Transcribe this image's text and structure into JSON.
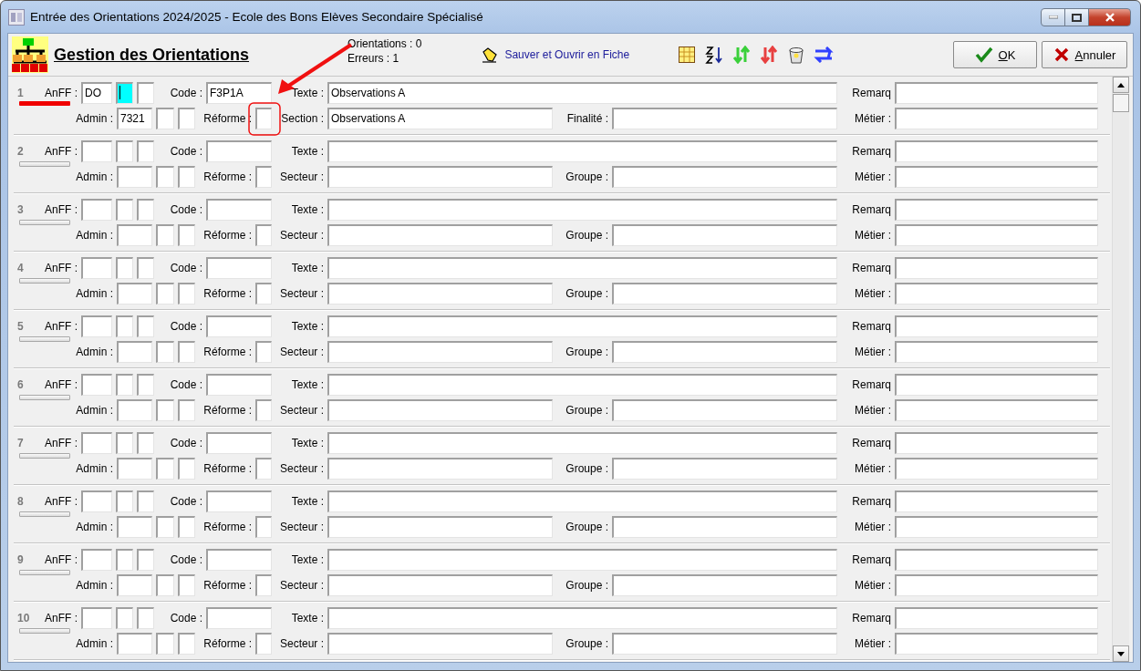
{
  "window": {
    "title": "Entrée des Orientations 2024/2025  -  Ecole des Bons Elèves Secondaire Spécialisé"
  },
  "header": {
    "title": "Gestion des Orientations",
    "stats": [
      "Orientations : 0",
      "Erreurs : 1"
    ],
    "save_link": "Sauver et Ouvrir en Fiche"
  },
  "buttons": [
    {
      "label": "OK",
      "kind": "ok"
    },
    {
      "label": "Annuler",
      "kind": "cancel"
    }
  ],
  "rows": [
    {
      "number": "1",
      "marked": true,
      "line1": [
        {
          "label": "AnFF :",
          "inputs": [
            {
              "value": "DO",
              "focused": false
            },
            {
              "focused": true
            },
            {
              "focused": false
            }
          ]
        },
        {
          "label": "Code :",
          "inputs": [
            {
              "value": "F3P1A",
              "focused": false
            }
          ]
        },
        {
          "label": "Texte :",
          "inputs": [
            {
              "value": "Observations A",
              "focused": false
            }
          ]
        },
        {
          "label": "Remarq",
          "inputs": [
            {
              "focused": false
            }
          ]
        }
      ],
      "line2": [
        {
          "label": "Admin :",
          "inputs": [
            {
              "value": "7321",
              "focused": false
            },
            {
              "focused": false
            },
            {
              "focused": false
            }
          ]
        },
        {
          "label": "Réforme :",
          "inputs": [
            {
              "focused": false
            }
          ]
        },
        {
          "label": "Section :",
          "inputs": [
            {
              "value": "Observations A",
              "focused": false
            }
          ]
        },
        {
          "label": "Finalité :",
          "inputs": [
            {
              "focused": false
            }
          ]
        },
        {
          "label": "Métier :",
          "inputs": [
            {
              "focused": false
            }
          ]
        }
      ]
    },
    {
      "number": "2",
      "marked": false,
      "line1": [
        {
          "label": "AnFF :",
          "inputs": [
            {
              "focused": false
            },
            {
              "focused": false
            },
            {
              "focused": false
            }
          ]
        },
        {
          "label": "Code :",
          "inputs": [
            {
              "focused": false
            }
          ]
        },
        {
          "label": "Texte :",
          "inputs": [
            {
              "focused": false
            }
          ]
        },
        {
          "label": "Remarq",
          "inputs": [
            {
              "focused": false
            }
          ]
        }
      ],
      "line2": [
        {
          "label": "Admin :",
          "inputs": [
            {
              "focused": false
            },
            {
              "focused": false
            },
            {
              "focused": false
            }
          ]
        },
        {
          "label": "Réforme :",
          "inputs": [
            {
              "focused": false
            }
          ]
        },
        {
          "label": "Secteur :",
          "inputs": [
            {
              "focused": false
            }
          ]
        },
        {
          "label": "Groupe :",
          "inputs": [
            {
              "focused": false
            }
          ]
        },
        {
          "label": "Métier :",
          "inputs": [
            {
              "focused": false
            }
          ]
        }
      ]
    },
    {
      "number": "3",
      "marked": false,
      "line1": [
        {
          "label": "AnFF :",
          "inputs": [
            {
              "focused": false
            },
            {
              "focused": false
            },
            {
              "focused": false
            }
          ]
        },
        {
          "label": "Code :",
          "inputs": [
            {
              "focused": false
            }
          ]
        },
        {
          "label": "Texte :",
          "inputs": [
            {
              "focused": false
            }
          ]
        },
        {
          "label": "Remarq",
          "inputs": [
            {
              "focused": false
            }
          ]
        }
      ],
      "line2": [
        {
          "label": "Admin :",
          "inputs": [
            {
              "focused": false
            },
            {
              "focused": false
            },
            {
              "focused": false
            }
          ]
        },
        {
          "label": "Réforme :",
          "inputs": [
            {
              "focused": false
            }
          ]
        },
        {
          "label": "Secteur :",
          "inputs": [
            {
              "focused": false
            }
          ]
        },
        {
          "label": "Groupe :",
          "inputs": [
            {
              "focused": false
            }
          ]
        },
        {
          "label": "Métier :",
          "inputs": [
            {
              "focused": false
            }
          ]
        }
      ]
    },
    {
      "number": "4",
      "marked": false,
      "line1": [
        {
          "label": "AnFF :",
          "inputs": [
            {
              "focused": false
            },
            {
              "focused": false
            },
            {
              "focused": false
            }
          ]
        },
        {
          "label": "Code :",
          "inputs": [
            {
              "focused": false
            }
          ]
        },
        {
          "label": "Texte :",
          "inputs": [
            {
              "focused": false
            }
          ]
        },
        {
          "label": "Remarq",
          "inputs": [
            {
              "focused": false
            }
          ]
        }
      ],
      "line2": [
        {
          "label": "Admin :",
          "inputs": [
            {
              "focused": false
            },
            {
              "focused": false
            },
            {
              "focused": false
            }
          ]
        },
        {
          "label": "Réforme :",
          "inputs": [
            {
              "focused": false
            }
          ]
        },
        {
          "label": "Secteur :",
          "inputs": [
            {
              "focused": false
            }
          ]
        },
        {
          "label": "Groupe :",
          "inputs": [
            {
              "focused": false
            }
          ]
        },
        {
          "label": "Métier :",
          "inputs": [
            {
              "focused": false
            }
          ]
        }
      ]
    },
    {
      "number": "5",
      "marked": false,
      "line1": [
        {
          "label": "AnFF :",
          "inputs": [
            {
              "focused": false
            },
            {
              "focused": false
            },
            {
              "focused": false
            }
          ]
        },
        {
          "label": "Code :",
          "inputs": [
            {
              "focused": false
            }
          ]
        },
        {
          "label": "Texte :",
          "inputs": [
            {
              "focused": false
            }
          ]
        },
        {
          "label": "Remarq",
          "inputs": [
            {
              "focused": false
            }
          ]
        }
      ],
      "line2": [
        {
          "label": "Admin :",
          "inputs": [
            {
              "focused": false
            },
            {
              "focused": false
            },
            {
              "focused": false
            }
          ]
        },
        {
          "label": "Réforme :",
          "inputs": [
            {
              "focused": false
            }
          ]
        },
        {
          "label": "Secteur :",
          "inputs": [
            {
              "focused": false
            }
          ]
        },
        {
          "label": "Groupe :",
          "inputs": [
            {
              "focused": false
            }
          ]
        },
        {
          "label": "Métier :",
          "inputs": [
            {
              "focused": false
            }
          ]
        }
      ]
    },
    {
      "number": "6",
      "marked": false,
      "line1": [
        {
          "label": "AnFF :",
          "inputs": [
            {
              "focused": false
            },
            {
              "focused": false
            },
            {
              "focused": false
            }
          ]
        },
        {
          "label": "Code :",
          "inputs": [
            {
              "focused": false
            }
          ]
        },
        {
          "label": "Texte :",
          "inputs": [
            {
              "focused": false
            }
          ]
        },
        {
          "label": "Remarq",
          "inputs": [
            {
              "focused": false
            }
          ]
        }
      ],
      "line2": [
        {
          "label": "Admin :",
          "inputs": [
            {
              "focused": false
            },
            {
              "focused": false
            },
            {
              "focused": false
            }
          ]
        },
        {
          "label": "Réforme :",
          "inputs": [
            {
              "focused": false
            }
          ]
        },
        {
          "label": "Secteur :",
          "inputs": [
            {
              "focused": false
            }
          ]
        },
        {
          "label": "Groupe :",
          "inputs": [
            {
              "focused": false
            }
          ]
        },
        {
          "label": "Métier :",
          "inputs": [
            {
              "focused": false
            }
          ]
        }
      ]
    },
    {
      "number": "7",
      "marked": false,
      "line1": [
        {
          "label": "AnFF :",
          "inputs": [
            {
              "focused": false
            },
            {
              "focused": false
            },
            {
              "focused": false
            }
          ]
        },
        {
          "label": "Code :",
          "inputs": [
            {
              "focused": false
            }
          ]
        },
        {
          "label": "Texte :",
          "inputs": [
            {
              "focused": false
            }
          ]
        },
        {
          "label": "Remarq",
          "inputs": [
            {
              "focused": false
            }
          ]
        }
      ],
      "line2": [
        {
          "label": "Admin :",
          "inputs": [
            {
              "focused": false
            },
            {
              "focused": false
            },
            {
              "focused": false
            }
          ]
        },
        {
          "label": "Réforme :",
          "inputs": [
            {
              "focused": false
            }
          ]
        },
        {
          "label": "Secteur :",
          "inputs": [
            {
              "focused": false
            }
          ]
        },
        {
          "label": "Groupe :",
          "inputs": [
            {
              "focused": false
            }
          ]
        },
        {
          "label": "Métier :",
          "inputs": [
            {
              "focused": false
            }
          ]
        }
      ]
    },
    {
      "number": "8",
      "marked": false,
      "line1": [
        {
          "label": "AnFF :",
          "inputs": [
            {
              "focused": false
            },
            {
              "focused": false
            },
            {
              "focused": false
            }
          ]
        },
        {
          "label": "Code :",
          "inputs": [
            {
              "focused": false
            }
          ]
        },
        {
          "label": "Texte :",
          "inputs": [
            {
              "focused": false
            }
          ]
        },
        {
          "label": "Remarq",
          "inputs": [
            {
              "focused": false
            }
          ]
        }
      ],
      "line2": [
        {
          "label": "Admin :",
          "inputs": [
            {
              "focused": false
            },
            {
              "focused": false
            },
            {
              "focused": false
            }
          ]
        },
        {
          "label": "Réforme :",
          "inputs": [
            {
              "focused": false
            }
          ]
        },
        {
          "label": "Secteur :",
          "inputs": [
            {
              "focused": false
            }
          ]
        },
        {
          "label": "Groupe :",
          "inputs": [
            {
              "focused": false
            }
          ]
        },
        {
          "label": "Métier :",
          "inputs": [
            {
              "focused": false
            }
          ]
        }
      ]
    },
    {
      "number": "9",
      "marked": false,
      "line1": [
        {
          "label": "AnFF :",
          "inputs": [
            {
              "focused": false
            },
            {
              "focused": false
            },
            {
              "focused": false
            }
          ]
        },
        {
          "label": "Code :",
          "inputs": [
            {
              "focused": false
            }
          ]
        },
        {
          "label": "Texte :",
          "inputs": [
            {
              "focused": false
            }
          ]
        },
        {
          "label": "Remarq",
          "inputs": [
            {
              "focused": false
            }
          ]
        }
      ],
      "line2": [
        {
          "label": "Admin :",
          "inputs": [
            {
              "focused": false
            },
            {
              "focused": false
            },
            {
              "focused": false
            }
          ]
        },
        {
          "label": "Réforme :",
          "inputs": [
            {
              "focused": false
            }
          ]
        },
        {
          "label": "Secteur :",
          "inputs": [
            {
              "focused": false
            }
          ]
        },
        {
          "label": "Groupe :",
          "inputs": [
            {
              "focused": false
            }
          ]
        },
        {
          "label": "Métier :",
          "inputs": [
            {
              "focused": false
            }
          ]
        }
      ]
    },
    {
      "number": "10",
      "marked": false,
      "line1": [
        {
          "label": "AnFF :",
          "inputs": [
            {
              "focused": false
            },
            {
              "focused": false
            },
            {
              "focused": false
            }
          ]
        },
        {
          "label": "Code :",
          "inputs": [
            {
              "focused": false
            }
          ]
        },
        {
          "label": "Texte :",
          "inputs": [
            {
              "focused": false
            }
          ]
        },
        {
          "label": "Remarq",
          "inputs": [
            {
              "focused": false
            }
          ]
        }
      ],
      "line2": [
        {
          "label": "Admin :",
          "inputs": [
            {
              "focused": false
            },
            {
              "focused": false
            },
            {
              "focused": false
            }
          ]
        },
        {
          "label": "Réforme :",
          "inputs": [
            {
              "focused": false
            }
          ]
        },
        {
          "label": "Secteur :",
          "inputs": [
            {
              "focused": false
            }
          ]
        },
        {
          "label": "Groupe :",
          "inputs": [
            {
              "focused": false
            }
          ]
        },
        {
          "label": "Métier :",
          "inputs": [
            {
              "focused": false
            }
          ]
        }
      ]
    }
  ]
}
